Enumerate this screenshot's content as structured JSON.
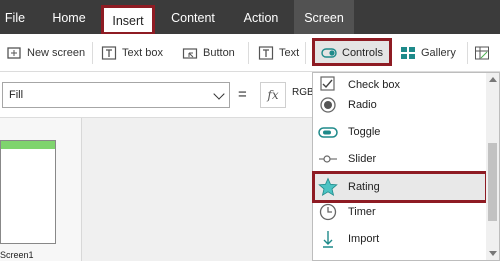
{
  "tabs": [
    {
      "label": "File"
    },
    {
      "label": "Home"
    },
    {
      "label": "Insert"
    },
    {
      "label": "Content"
    },
    {
      "label": "Action"
    },
    {
      "label": "Screen"
    }
  ],
  "toolbar": {
    "new_screen": "New screen",
    "text_box": "Text box",
    "button": "Button",
    "text": "Text",
    "controls": "Controls",
    "gallery": "Gallery"
  },
  "formula": {
    "property": "Fill",
    "equals": "=",
    "fx": "fx",
    "value": "RGB"
  },
  "dropdown": {
    "items": [
      {
        "label": "Check box",
        "icon": "checkbox-icon"
      },
      {
        "label": "Radio",
        "icon": "radio-icon"
      },
      {
        "label": "Toggle",
        "icon": "toggle-icon"
      },
      {
        "label": "Slider",
        "icon": "slider-icon"
      },
      {
        "label": "Rating",
        "icon": "star-icon"
      },
      {
        "label": "Timer",
        "icon": "clock-icon"
      },
      {
        "label": "Import",
        "icon": "import-icon"
      }
    ]
  },
  "screens": [
    {
      "label": "Screen1"
    }
  ],
  "colors": {
    "highlight": "#8e1b23",
    "accent": "#1e8a8a",
    "tabbar": "#3b3b3b",
    "thumb_header": "#7fd46e"
  }
}
